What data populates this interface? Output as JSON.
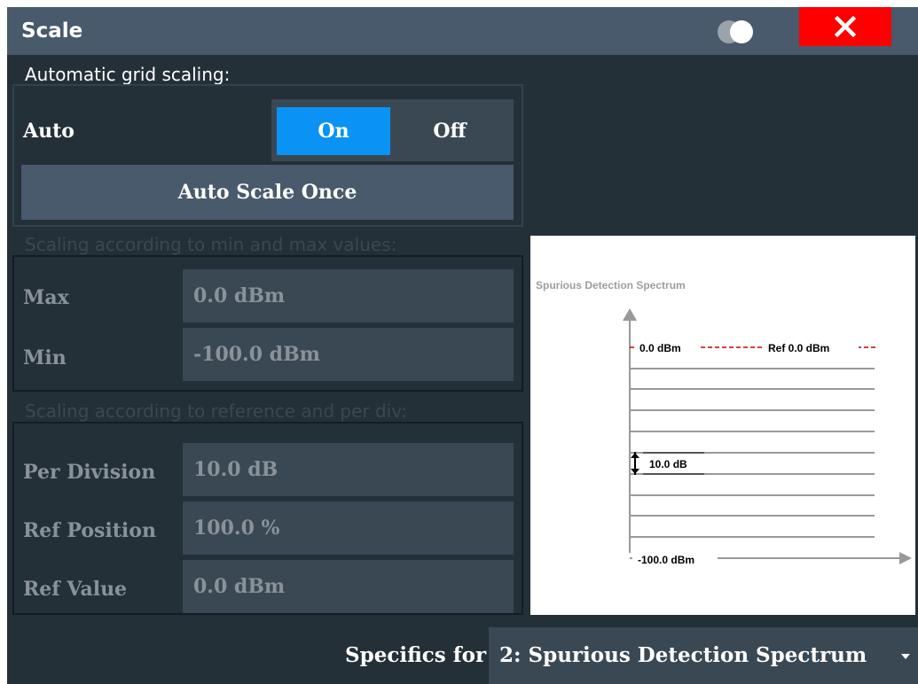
{
  "dialog": {
    "title": "Scale"
  },
  "auto_section": {
    "label": "Automatic grid scaling:",
    "auto_label": "Auto",
    "on_label": "On",
    "off_label": "Off",
    "selected": "On",
    "auto_scale_once_label": "Auto Scale Once"
  },
  "minmax_section": {
    "label": "Scaling according to min and max values:",
    "max_label": "Max",
    "max_value": "0.0 dBm",
    "min_label": "Min",
    "min_value": "-100.0 dBm"
  },
  "ref_section": {
    "label": "Scaling according to reference and per div:",
    "per_division_label": "Per Division",
    "per_division_value": "10.0 dB",
    "ref_position_label": "Ref Position",
    "ref_position_value": "100.0 %",
    "ref_value_label": "Ref Value",
    "ref_value_value": "0.0 dBm"
  },
  "preview": {
    "title": "Spurious Detection Spectrum",
    "top_label": "0.0 dBm",
    "ref_label": "Ref 0.0 dBm",
    "div_label": "10.0 dB",
    "bottom_label": "-100.0 dBm"
  },
  "specifics": {
    "label": "Specifics for",
    "value": "2: Spurious Detection Spectrum"
  },
  "colors": {
    "background": "#243038",
    "title_bar": "#485a6b",
    "close_button": "#ff0000",
    "on_active": "#0a93f5",
    "field": "#3a4853",
    "ref_line": "#cc0000"
  },
  "icons": [
    "toggle-display-icon",
    "close-icon",
    "dropdown-arrow-icon",
    "up-arrow-icon",
    "right-arrow-icon"
  ]
}
